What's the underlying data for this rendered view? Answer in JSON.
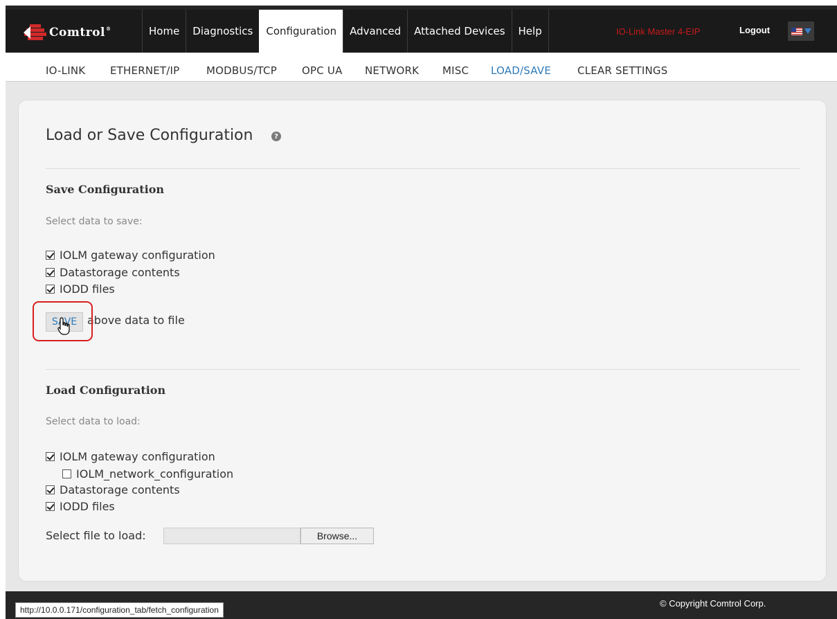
{
  "brand": {
    "name": "Comtrol",
    "registered": "®"
  },
  "nav": {
    "items": [
      {
        "label": "Home",
        "active": false
      },
      {
        "label": "Diagnostics",
        "active": false
      },
      {
        "label": "Configuration",
        "active": true
      },
      {
        "label": "Advanced",
        "active": false
      },
      {
        "label": "Attached Devices",
        "active": false
      },
      {
        "label": "Help",
        "active": false
      }
    ],
    "device_name": "IO-Link Master 4-EIP",
    "logout": "Logout",
    "language_icon": "us-flag-icon"
  },
  "subnav": {
    "items": [
      {
        "label": "IO-LINK",
        "active": false
      },
      {
        "label": "ETHERNET/IP",
        "active": false
      },
      {
        "label": "MODBUS/TCP",
        "active": false
      },
      {
        "label": "OPC UA",
        "active": false
      },
      {
        "label": "NETWORK",
        "active": false
      },
      {
        "label": "MISC",
        "active": false
      },
      {
        "label": "LOAD/SAVE",
        "active": true
      },
      {
        "label": "CLEAR SETTINGS",
        "active": false
      }
    ]
  },
  "page": {
    "title": "Load or Save Configuration",
    "help_icon": "question-circle-icon"
  },
  "save": {
    "title": "Save Configuration",
    "prompt": "Select data to save:",
    "options": [
      {
        "label": "IOLM gateway configuration",
        "checked": true
      },
      {
        "label": "Datastorage contents",
        "checked": true
      },
      {
        "label": "IODD files",
        "checked": true
      }
    ],
    "button": "SAVE",
    "button_tail": "above data to file"
  },
  "load": {
    "title": "Load Configuration",
    "prompt": "Select data to load:",
    "options": [
      {
        "label": "IOLM gateway configuration",
        "checked": true
      },
      {
        "label": "IOLM_network_configuration",
        "checked": false
      },
      {
        "label": "Datastorage contents",
        "checked": true
      },
      {
        "label": "IODD files",
        "checked": true
      }
    ],
    "file_label": "Select file to load:",
    "file_value": "",
    "browse": "Browse..."
  },
  "footer": {
    "copyright": "© Copyright Comtrol Corp.",
    "status_url": "http://10.0.0.171/configuration_tab/fetch_configuration"
  },
  "colors": {
    "accent": "#2f7ab8",
    "device_name": "#c81a1a",
    "highlight": "#d9201f",
    "nav_bg": "#1a1a1a"
  }
}
